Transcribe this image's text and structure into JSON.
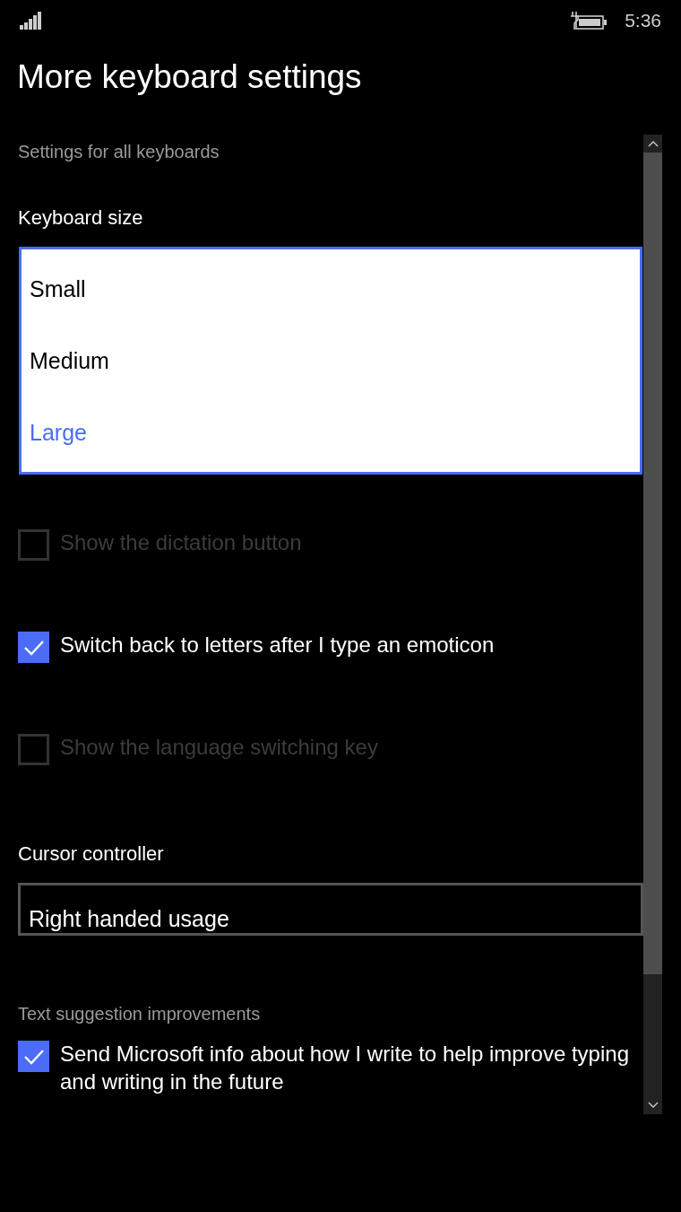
{
  "status_bar": {
    "time": "5:36"
  },
  "title": "More keyboard settings",
  "section_header": "Settings for all keyboards",
  "keyboard_size": {
    "label": "Keyboard size",
    "options": [
      {
        "label": "Small",
        "selected": false
      },
      {
        "label": "Medium",
        "selected": false
      },
      {
        "label": "Large",
        "selected": true
      }
    ]
  },
  "options": [
    {
      "label": "Show the dictation button",
      "checked": false,
      "disabled": true
    },
    {
      "label": "Switch back to letters after I type an emoticon",
      "checked": true,
      "disabled": false
    },
    {
      "label": "Show the language switching key",
      "checked": false,
      "disabled": true
    }
  ],
  "cursor_controller": {
    "label": "Cursor controller",
    "value": "Right handed usage"
  },
  "text_suggestion": {
    "header": "Text suggestion improvements",
    "option": {
      "label": "Send Microsoft info about how I write to help improve typing and writing in the future",
      "checked": true,
      "disabled": false
    }
  }
}
